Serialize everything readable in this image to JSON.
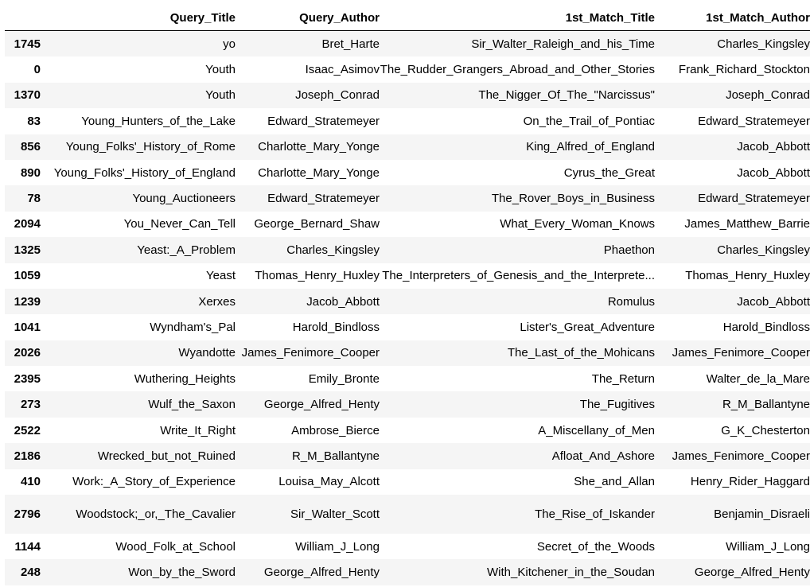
{
  "table": {
    "columns": [
      "",
      "Query_Title",
      "Query_Author",
      "1st_Match_Title",
      "1st_Match_Author"
    ],
    "rows": [
      {
        "index": "1745",
        "query_title": "yo",
        "query_author": "Bret_Harte",
        "match_title": "Sir_Walter_Raleigh_and_his_Time",
        "match_author": "Charles_Kingsley"
      },
      {
        "index": "0",
        "query_title": "Youth",
        "query_author": "Isaac_Asimov",
        "match_title": "The_Rudder_Grangers_Abroad_and_Other_Stories",
        "match_author": "Frank_Richard_Stockton"
      },
      {
        "index": "1370",
        "query_title": "Youth",
        "query_author": "Joseph_Conrad",
        "match_title": "The_Nigger_Of_The_\"Narcissus\"",
        "match_author": "Joseph_Conrad"
      },
      {
        "index": "83",
        "query_title": "Young_Hunters_of_the_Lake",
        "query_author": "Edward_Stratemeyer",
        "match_title": "On_the_Trail_of_Pontiac",
        "match_author": "Edward_Stratemeyer"
      },
      {
        "index": "856",
        "query_title": "Young_Folks'_History_of_Rome",
        "query_author": "Charlotte_Mary_Yonge",
        "match_title": "King_Alfred_of_England",
        "match_author": "Jacob_Abbott"
      },
      {
        "index": "890",
        "query_title": "Young_Folks'_History_of_England",
        "query_author": "Charlotte_Mary_Yonge",
        "match_title": "Cyrus_the_Great",
        "match_author": "Jacob_Abbott"
      },
      {
        "index": "78",
        "query_title": "Young_Auctioneers",
        "query_author": "Edward_Stratemeyer",
        "match_title": "The_Rover_Boys_in_Business",
        "match_author": "Edward_Stratemeyer"
      },
      {
        "index": "2094",
        "query_title": "You_Never_Can_Tell",
        "query_author": "George_Bernard_Shaw",
        "match_title": "What_Every_Woman_Knows",
        "match_author": "James_Matthew_Barrie"
      },
      {
        "index": "1325",
        "query_title": "Yeast:_A_Problem",
        "query_author": "Charles_Kingsley",
        "match_title": "Phaethon",
        "match_author": "Charles_Kingsley"
      },
      {
        "index": "1059",
        "query_title": "Yeast",
        "query_author": "Thomas_Henry_Huxley",
        "match_title": "The_Interpreters_of_Genesis_and_the_Interprete...",
        "match_author": "Thomas_Henry_Huxley"
      },
      {
        "index": "1239",
        "query_title": "Xerxes",
        "query_author": "Jacob_Abbott",
        "match_title": "Romulus",
        "match_author": "Jacob_Abbott"
      },
      {
        "index": "1041",
        "query_title": "Wyndham's_Pal",
        "query_author": "Harold_Bindloss",
        "match_title": "Lister's_Great_Adventure",
        "match_author": "Harold_Bindloss"
      },
      {
        "index": "2026",
        "query_title": "Wyandotte",
        "query_author": "James_Fenimore_Cooper",
        "match_title": "The_Last_of_the_Mohicans",
        "match_author": "James_Fenimore_Cooper"
      },
      {
        "index": "2395",
        "query_title": "Wuthering_Heights",
        "query_author": "Emily_Bronte",
        "match_title": "The_Return",
        "match_author": "Walter_de_la_Mare"
      },
      {
        "index": "273",
        "query_title": "Wulf_the_Saxon",
        "query_author": "George_Alfred_Henty",
        "match_title": "The_Fugitives",
        "match_author": "R_M_Ballantyne"
      },
      {
        "index": "2522",
        "query_title": "Write_It_Right",
        "query_author": "Ambrose_Bierce",
        "match_title": "A_Miscellany_of_Men",
        "match_author": "G_K_Chesterton"
      },
      {
        "index": "2186",
        "query_title": "Wrecked_but_not_Ruined",
        "query_author": "R_M_Ballantyne",
        "match_title": "Afloat_And_Ashore",
        "match_author": "James_Fenimore_Cooper"
      },
      {
        "index": "410",
        "query_title": "Work:_A_Story_of_Experience",
        "query_author": "Louisa_May_Alcott",
        "match_title": "She_and_Allan",
        "match_author": "Henry_Rider_Haggard"
      },
      {
        "index": "2796",
        "query_title": "Woodstock;_or,_The_Cavalier",
        "query_author": "Sir_Walter_Scott",
        "match_title": "The_Rise_of_Iskander",
        "match_author": "Benjamin_Disraeli"
      },
      {
        "index": "1144",
        "query_title": "Wood_Folk_at_School",
        "query_author": "William_J_Long",
        "match_title": "Secret_of_the_Woods",
        "match_author": "William_J_Long"
      },
      {
        "index": "248",
        "query_title": "Won_by_the_Sword",
        "query_author": "George_Alfred_Henty",
        "match_title": "With_Kitchener_in_the_Soudan",
        "match_author": "George_Alfred_Henty"
      }
    ]
  }
}
